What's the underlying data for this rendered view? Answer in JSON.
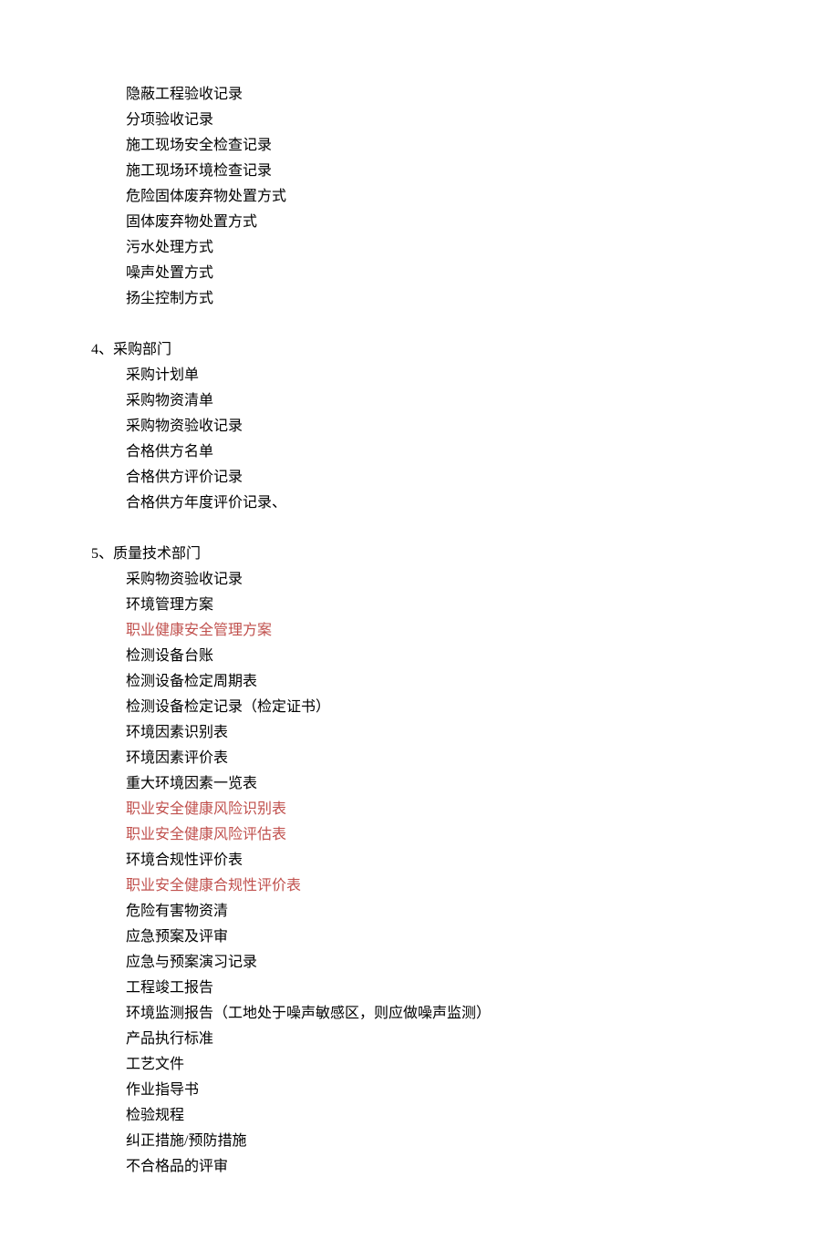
{
  "section3_trailing_items": [
    "隐蔽工程验收记录",
    "分项验收记录",
    "施工现场安全检查记录",
    "施工现场环境检查记录",
    "危险固体废弃物处置方式",
    "固体废弃物处置方式",
    "污水处理方式",
    "噪声处置方式",
    "扬尘控制方式"
  ],
  "section4": {
    "header": "4、采购部门",
    "items": [
      "采购计划单",
      "采购物资清单",
      "采购物资验收记录",
      "合格供方名单",
      "合格供方评价记录",
      "合格供方年度评价记录、"
    ]
  },
  "section5": {
    "header": "5、质量技术部门",
    "items": [
      {
        "text": "采购物资验收记录",
        "highlight": false
      },
      {
        "text": "环境管理方案",
        "highlight": false
      },
      {
        "text": "职业健康安全管理方案",
        "highlight": true
      },
      {
        "text": "检测设备台账",
        "highlight": false
      },
      {
        "text": "检测设备检定周期表",
        "highlight": false
      },
      {
        "text": "检测设备检定记录（检定证书）",
        "highlight": false
      },
      {
        "text": "环境因素识别表",
        "highlight": false
      },
      {
        "text": "环境因素评价表",
        "highlight": false
      },
      {
        "text": "重大环境因素一览表",
        "highlight": false
      },
      {
        "text": "职业安全健康风险识别表",
        "highlight": true
      },
      {
        "text": "职业安全健康风险评估表",
        "highlight": true
      },
      {
        "text": "环境合规性评价表",
        "highlight": false
      },
      {
        "text": "职业安全健康合规性评价表",
        "highlight": true
      },
      {
        "text": "危险有害物资清",
        "highlight": false
      },
      {
        "text": "应急预案及评审",
        "highlight": false
      },
      {
        "text": "应急与预案演习记录",
        "highlight": false
      },
      {
        "text": "工程竣工报告",
        "highlight": false
      },
      {
        "text": "环境监测报告（工地处于噪声敏感区，则应做噪声监测）",
        "highlight": false
      },
      {
        "text": "产品执行标准",
        "highlight": false
      },
      {
        "text": "工艺文件",
        "highlight": false
      },
      {
        "text": "作业指导书",
        "highlight": false
      },
      {
        "text": "检验规程",
        "highlight": false
      },
      {
        "text": "纠正措施/预防措施",
        "highlight": false
      },
      {
        "text": "不合格品的评审",
        "highlight": false
      }
    ]
  }
}
